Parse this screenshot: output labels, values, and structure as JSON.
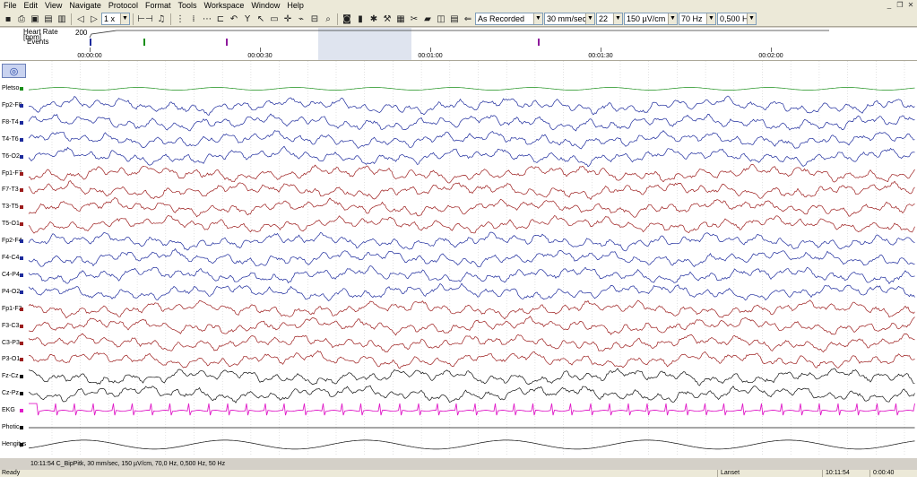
{
  "menu": [
    "File",
    "Edit",
    "View",
    "Navigate",
    "Protocol",
    "Format",
    "Tools",
    "Workspace",
    "Window",
    "Help"
  ],
  "toolbar": {
    "zoom": "1 x",
    "montage": "As Recorded",
    "speed": "30 mm/sec",
    "channels": "22",
    "sensitivity": "150 µV/cm",
    "lowpass": "70 Hz",
    "highpass": "0,500 H"
  },
  "overview": {
    "hr_label": "Heart Rate",
    "hr_unit": "[bpm]",
    "hr_value": "200",
    "events_label": "Events",
    "ticks": [
      "00:00:00",
      "00:00:30",
      "00:01:00",
      "00:01:30",
      "00:02:00"
    ]
  },
  "channels": [
    {
      "label": "Pletso",
      "color": "#1a8f1a"
    },
    {
      "label": "Fp2-F8",
      "color": "#1c2a9c"
    },
    {
      "label": "F8-T4",
      "color": "#1c2a9c"
    },
    {
      "label": "T4-T6",
      "color": "#1c2a9c"
    },
    {
      "label": "T6-O2",
      "color": "#1c2a9c"
    },
    {
      "label": "Fp1-F7",
      "color": "#9c1c1c"
    },
    {
      "label": "F7-T3",
      "color": "#9c1c1c"
    },
    {
      "label": "T3-T5",
      "color": "#9c1c1c"
    },
    {
      "label": "T5-O1",
      "color": "#9c1c1c"
    },
    {
      "label": "Fp2-F4",
      "color": "#1c2a9c"
    },
    {
      "label": "F4-C4",
      "color": "#1c2a9c"
    },
    {
      "label": "C4-P4",
      "color": "#1c2a9c"
    },
    {
      "label": "P4-O2",
      "color": "#1c2a9c"
    },
    {
      "label": "Fp1-F3",
      "color": "#9c1c1c"
    },
    {
      "label": "F3-C3",
      "color": "#9c1c1c"
    },
    {
      "label": "C3-P3",
      "color": "#9c1c1c"
    },
    {
      "label": "P3-O1",
      "color": "#9c1c1c"
    },
    {
      "label": "Fz-Cz",
      "color": "#111111"
    },
    {
      "label": "Cz-Pz",
      "color": "#111111"
    },
    {
      "label": "EKG",
      "color": "#e01cc8"
    },
    {
      "label": "Photic",
      "color": "#111111"
    },
    {
      "label": "Hengitys",
      "color": "#111111"
    }
  ],
  "info_line": "10:11:54 C_BipPitk, 30 mm/sec, 150 µV/cm, 70,0 Hz, 0,500 Hz, 50 Hz",
  "status": {
    "ready": "Ready",
    "user": "Lanset",
    "clock": "10:11:54",
    "elapsed": "0:00:40"
  }
}
